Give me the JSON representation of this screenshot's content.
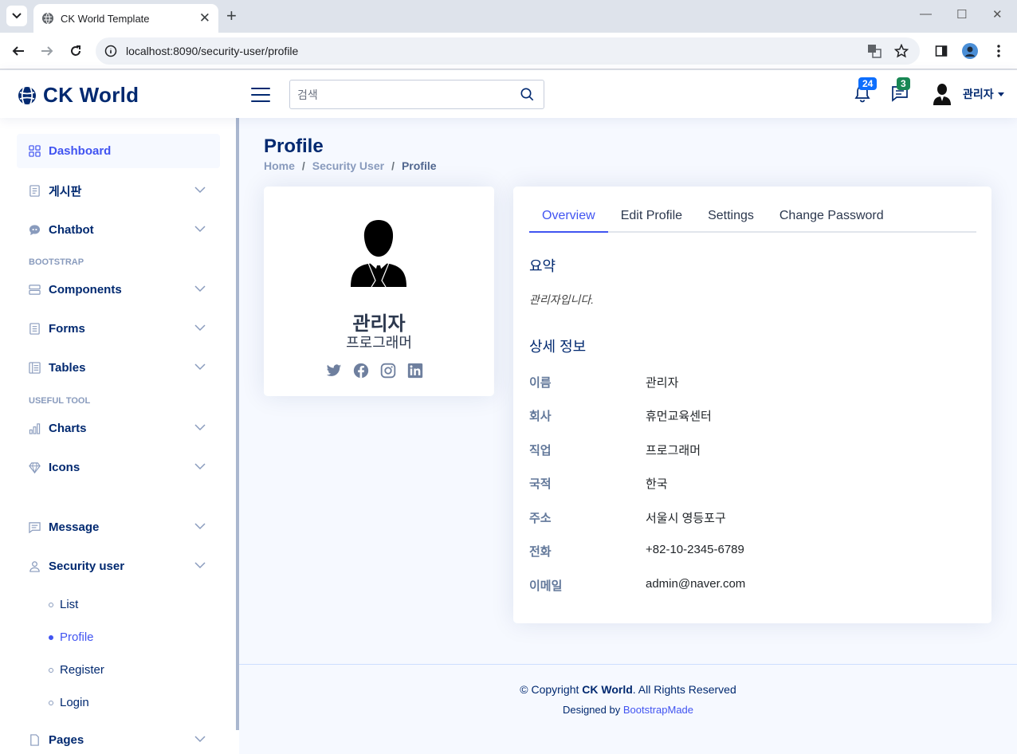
{
  "browser": {
    "tab_title": "CK World Template",
    "url": "localhost:8090/security-user/profile",
    "new_tab": "+"
  },
  "header": {
    "logo": "CK World",
    "search_placeholder": "검색",
    "notifications_count": "24",
    "messages_count": "3",
    "user_name": "관리자",
    "accent_blue": "#4154f1",
    "badge_notifications_color": "#0d6efd",
    "badge_messages_color": "#198754"
  },
  "sidebar": {
    "dashboard": "Dashboard",
    "board": "게시판",
    "chatbot": "Chatbot",
    "heading_bootstrap": "BOOTSTRAP",
    "components": "Components",
    "forms": "Forms",
    "tables": "Tables",
    "heading_useful": "USEFUL TOOL",
    "charts": "Charts",
    "icons": "Icons",
    "message": "Message",
    "security_user": "Security user",
    "sub_list": "List",
    "sub_profile": "Profile",
    "sub_register": "Register",
    "sub_login": "Login",
    "pages": "Pages"
  },
  "main": {
    "title": "Profile",
    "breadcrumb": [
      "Home",
      "Security User",
      "Profile"
    ]
  },
  "profile_card": {
    "name": "관리자",
    "job": "프로그래머",
    "socials": [
      "twitter-icon",
      "facebook-icon",
      "instagram-icon",
      "linkedin-icon"
    ]
  },
  "details": {
    "tabs": [
      "Overview",
      "Edit Profile",
      "Settings",
      "Change Password"
    ],
    "summary_title": "요약",
    "summary_text": "관리자입니다.",
    "detail_title": "상세 정보",
    "rows": [
      {
        "label": "이름",
        "value": "관리자"
      },
      {
        "label": "회사",
        "value": "휴먼교육센터"
      },
      {
        "label": "직업",
        "value": "프로그래머"
      },
      {
        "label": "국적",
        "value": "한국"
      },
      {
        "label": "주소",
        "value": "서울시 영등포구"
      },
      {
        "label": "전화",
        "value": "+82-10-2345-6789"
      },
      {
        "label": "이메일",
        "value": "admin@naver.com"
      }
    ]
  },
  "footer": {
    "copyright_prefix": "© Copyright",
    "copyright_brand": "CK World",
    "copyright_suffix": ". All Rights Reserved",
    "designed_by": "Designed by",
    "designer": "BootstrapMade"
  }
}
